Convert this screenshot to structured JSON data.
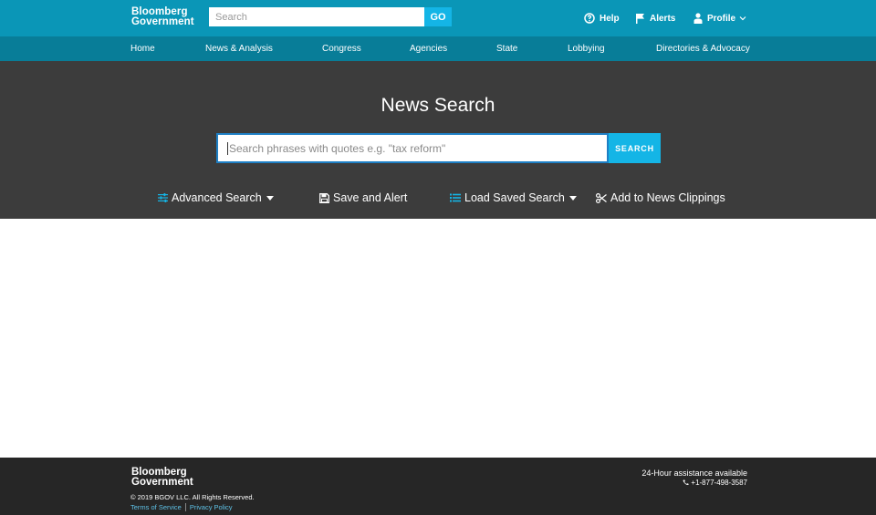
{
  "header": {
    "logo_line1": "Bloomberg",
    "logo_line2": "Government",
    "search_placeholder": "Search",
    "go_label": "GO",
    "help_label": "Help",
    "alerts_label": "Alerts",
    "profile_label": "Profile"
  },
  "nav": {
    "items": [
      {
        "label": "Home"
      },
      {
        "label": "News & Analysis"
      },
      {
        "label": "Congress"
      },
      {
        "label": "Agencies"
      },
      {
        "label": "State"
      },
      {
        "label": "Lobbying"
      },
      {
        "label": "Directories & Advocacy"
      }
    ]
  },
  "hero": {
    "title": "News Search",
    "search_placeholder": "Search phrases with quotes e.g. \"tax reform\"",
    "search_button": "SEARCH",
    "actions": {
      "advanced": "Advanced Search",
      "save_alert": "Save and Alert",
      "load_saved": "Load Saved Search",
      "clippings": "Add to News Clippings"
    }
  },
  "footer": {
    "logo_line1": "Bloomberg",
    "logo_line2": "Government",
    "copyright": "© 2019 BGOV LLC. All Rights Reserved.",
    "terms": "Terms of Service",
    "privacy": "Privacy Policy",
    "assistance": "24-Hour assistance available",
    "phone": "+1-877-498-3587"
  },
  "colors": {
    "topbar": "#0a96b7",
    "navbar": "#087d98",
    "hero_bg": "#3c3c3c",
    "accent": "#14b5e6",
    "footer_bg": "#262626"
  }
}
